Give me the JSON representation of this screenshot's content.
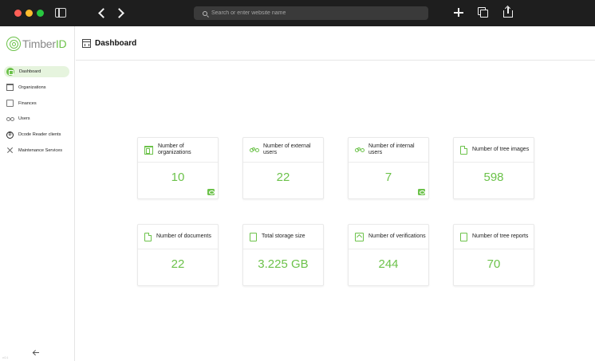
{
  "browser": {
    "url_placeholder": "Search or enter website name"
  },
  "sidebar": {
    "logo": {
      "text_main": "Timber",
      "text_accent": "ID"
    },
    "items": [
      {
        "label": "Dashboard",
        "icon": "dashboard-icon",
        "active": true
      },
      {
        "label": "Organizations",
        "icon": "building-icon",
        "active": false
      },
      {
        "label": "Finances",
        "icon": "finances-icon",
        "active": false
      },
      {
        "label": "Users",
        "icon": "users-icon",
        "active": false
      },
      {
        "label": "Dcode Reader clients",
        "icon": "dcode-icon",
        "active": false
      },
      {
        "label": "Maintenance Services",
        "icon": "tools-icon",
        "active": false
      }
    ],
    "version": "v.0.1"
  },
  "header": {
    "title": "Dashboard"
  },
  "cards": [
    {
      "label": "Number of organizations",
      "value": "10",
      "icon": "building-icon",
      "has_view_button": true
    },
    {
      "label": "Number of external users",
      "value": "22",
      "icon": "users-group-icon",
      "has_view_button": false
    },
    {
      "label": "Number of internal users",
      "value": "7",
      "icon": "users-group-icon",
      "has_view_button": true
    },
    {
      "label": "Number of tree images",
      "value": "598",
      "icon": "document-icon",
      "has_view_button": false
    },
    {
      "label": "Number of documents",
      "value": "22",
      "icon": "document-icon",
      "has_view_button": false
    },
    {
      "label": "Total storage size",
      "value": "3.225 GB",
      "icon": "file-icon",
      "has_view_button": false
    },
    {
      "label": "Number of verifications",
      "value": "244",
      "icon": "verification-icon",
      "has_view_button": false
    },
    {
      "label": "Number of tree reports",
      "value": "70",
      "icon": "file-icon",
      "has_view_button": false
    }
  ],
  "colors": {
    "accent": "#6cc24a",
    "active_bg": "#e6f4de",
    "chrome": "#1e1e1e"
  }
}
